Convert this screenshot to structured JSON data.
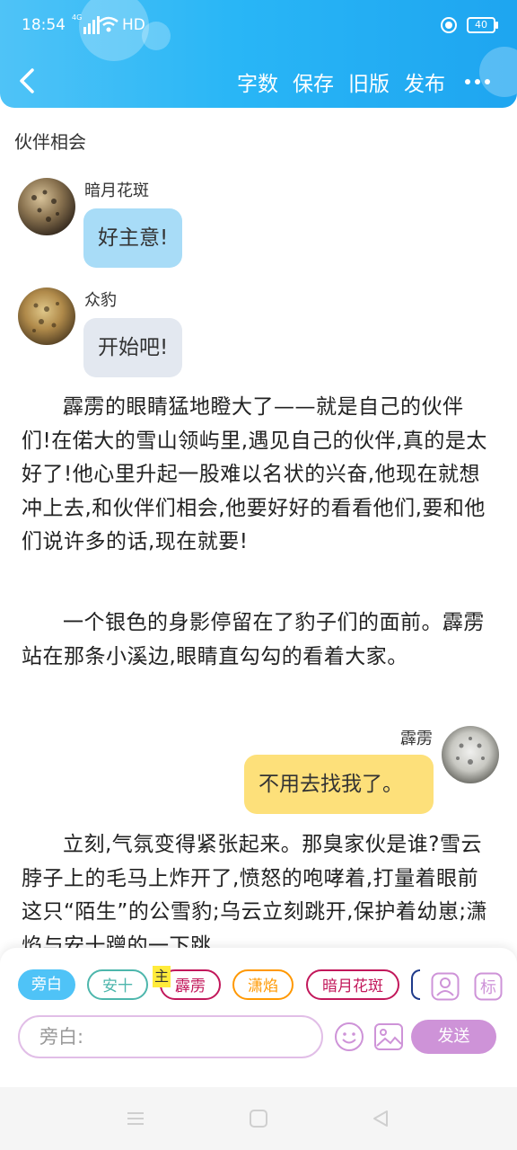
{
  "status": {
    "time": "18:54",
    "network": "4G",
    "hd": "HD",
    "battery": "40"
  },
  "toolbar": {
    "word_count": "字数",
    "save": "保存",
    "old_version": "旧版",
    "publish": "发布"
  },
  "chapter_title": "伙伴相会",
  "messages": [
    {
      "speaker": "暗月花斑",
      "text": "好主意!",
      "bubble_color": "#a8dcf7"
    },
    {
      "speaker": "众豹",
      "text": "开始吧!",
      "bubble_color": "#e3e8f0"
    },
    {
      "speaker": "霹雳",
      "text": "不用去找我了。",
      "bubble_color": "#fde07a"
    }
  ],
  "paragraphs": [
    "霹雳的眼睛猛地瞪大了——就是自己的伙伴们!在偌大的雪山领屿里,遇见自己的伙伴,真的是太好了!他心里升起一股难以名状的兴奋,他现在就想冲上去,和伙伴们相会,他要好好的看看他们,要和他们说许多的话,现在就要!",
    "一个银色的身影停留在了豹子们的面前。霹雳站在那条小溪边,眼睛直勾勾的看着大家。",
    "立刻,气氛变得紧张起来。那臭家伙是谁?雪云脖子上的毛马上炸开了,愤怒的咆哮着,打量着眼前这只“陌生”的公雪豹;乌云立刻跳开,保护着幼崽;潇焰与安十蹭的一下跳"
  ],
  "roles": [
    {
      "name": "旁白",
      "color": "#4fc3f7"
    },
    {
      "name": "安十",
      "color": "#4db6ac"
    },
    {
      "name": "霹雳",
      "color": "#c2185b"
    },
    {
      "name": "潇焰",
      "color": "#ff9800"
    },
    {
      "name": "暗月花斑",
      "color": "#c2185b"
    }
  ],
  "main_badge": "主",
  "input": {
    "placeholder": "旁白:"
  },
  "send_label": "发送",
  "icons": [
    "back-icon",
    "more-icon",
    "person-icon",
    "tag-icon",
    "emoji-icon",
    "image-icon",
    "menu-icon",
    "home-icon",
    "back-triangle-icon"
  ]
}
